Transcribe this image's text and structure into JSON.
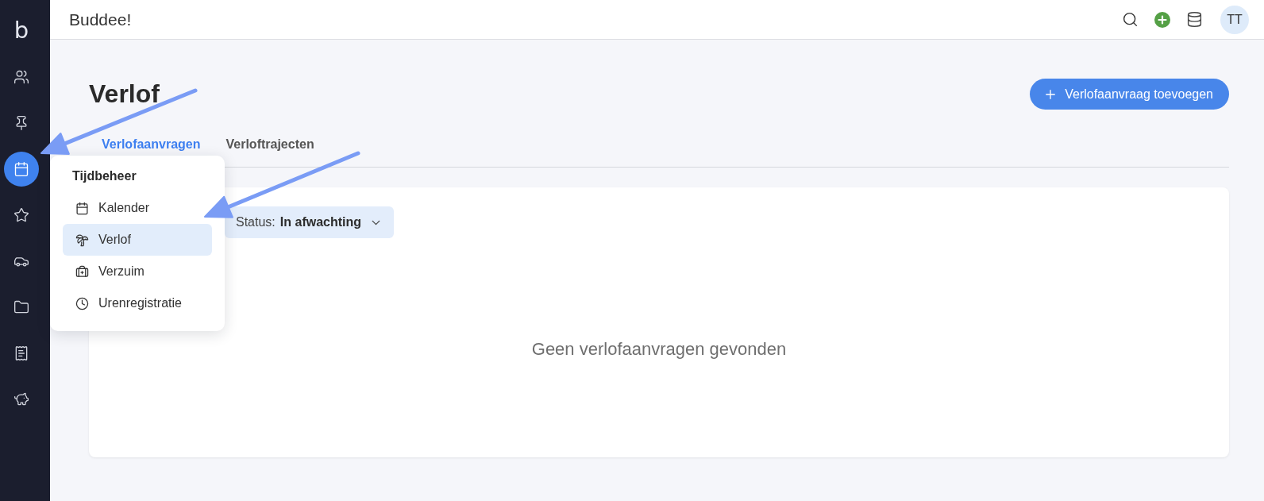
{
  "top_bar": {
    "title": "Buddee!",
    "avatar": "TT"
  },
  "sidebar": {
    "logo": "b",
    "items": [
      {
        "selected": false
      },
      {
        "selected": false
      },
      {
        "selected": true
      },
      {
        "selected": false
      },
      {
        "selected": false
      },
      {
        "selected": false
      },
      {
        "selected": false
      },
      {
        "selected": false
      }
    ]
  },
  "page": {
    "title": "Verlof",
    "add_button": "Verlofaanvraag toevoegen"
  },
  "tabs": [
    {
      "label": "Verlofaanvragen",
      "selected": true
    },
    {
      "label": "Verloftrajecten",
      "selected": false
    }
  ],
  "filter": {
    "label": "Status:",
    "value": "In afwachting"
  },
  "empty_message": "Geen verlofaanvragen gevonden",
  "menu": {
    "title": "Tijdbeheer",
    "items": [
      {
        "label": "Kalender",
        "selected": false
      },
      {
        "label": "Verlof",
        "selected": true
      },
      {
        "label": "Verzuim",
        "selected": false
      },
      {
        "label": "Urenregistratie",
        "selected": false
      }
    ]
  }
}
